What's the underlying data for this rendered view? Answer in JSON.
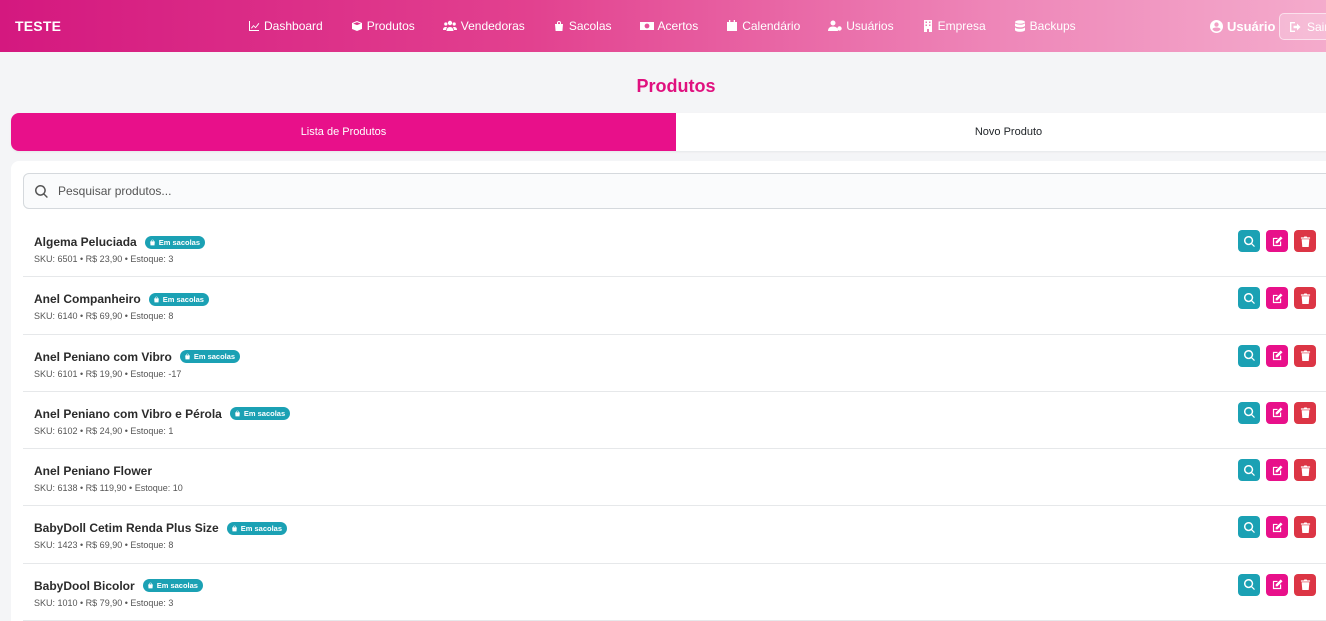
{
  "brand": "TESTE",
  "nav": [
    {
      "label": "Dashboard",
      "icon": "chart-line-icon"
    },
    {
      "label": "Produtos",
      "icon": "box-icon"
    },
    {
      "label": "Vendedoras",
      "icon": "users-icon"
    },
    {
      "label": "Sacolas",
      "icon": "shopping-bag-icon"
    },
    {
      "label": "Acertos",
      "icon": "money-icon"
    },
    {
      "label": "Calendário",
      "icon": "calendar-icon"
    },
    {
      "label": "Usuários",
      "icon": "user-gear-icon"
    },
    {
      "label": "Empresa",
      "icon": "building-icon"
    },
    {
      "label": "Backups",
      "icon": "database-icon"
    }
  ],
  "user": {
    "label": "Usuário"
  },
  "logout": {
    "label": "Sair"
  },
  "page": {
    "title": "Produtos"
  },
  "tabs": [
    {
      "label": "Lista de Produtos",
      "active": true
    },
    {
      "label": "Novo Produto",
      "active": false
    }
  ],
  "search": {
    "placeholder": "Pesquisar produtos...",
    "value": ""
  },
  "products": [
    {
      "name": "Algema Peluciada",
      "badge": "Em sacolas",
      "meta": "SKU: 6501 • R$ 23,90 • Estoque: 3"
    },
    {
      "name": "Anel Companheiro",
      "badge": "Em sacolas",
      "meta": "SKU: 6140 • R$ 69,90 • Estoque: 8"
    },
    {
      "name": "Anel Peniano com Vibro",
      "badge": "Em sacolas",
      "meta": "SKU: 6101 • R$ 19,90 • Estoque: -17"
    },
    {
      "name": "Anel Peniano com Vibro e Pérola",
      "badge": "Em sacolas",
      "meta": "SKU: 6102 • R$ 24,90 • Estoque: 1"
    },
    {
      "name": "Anel Peniano Flower",
      "badge": "",
      "meta": "SKU: 6138 • R$ 119,90 • Estoque: 10"
    },
    {
      "name": "BabyDoll Cetim Renda Plus Size",
      "badge": "Em sacolas",
      "meta": "SKU: 1423 • R$ 69,90 • Estoque: 8"
    },
    {
      "name": "BabyDool Bicolor",
      "badge": "Em sacolas",
      "meta": "SKU: 1010 • R$ 79,90 • Estoque: 3"
    }
  ],
  "colors": {
    "accent": "#e8108a",
    "badge": "#1ba1b4",
    "danger": "#dc3545",
    "title": "#e0117f"
  }
}
